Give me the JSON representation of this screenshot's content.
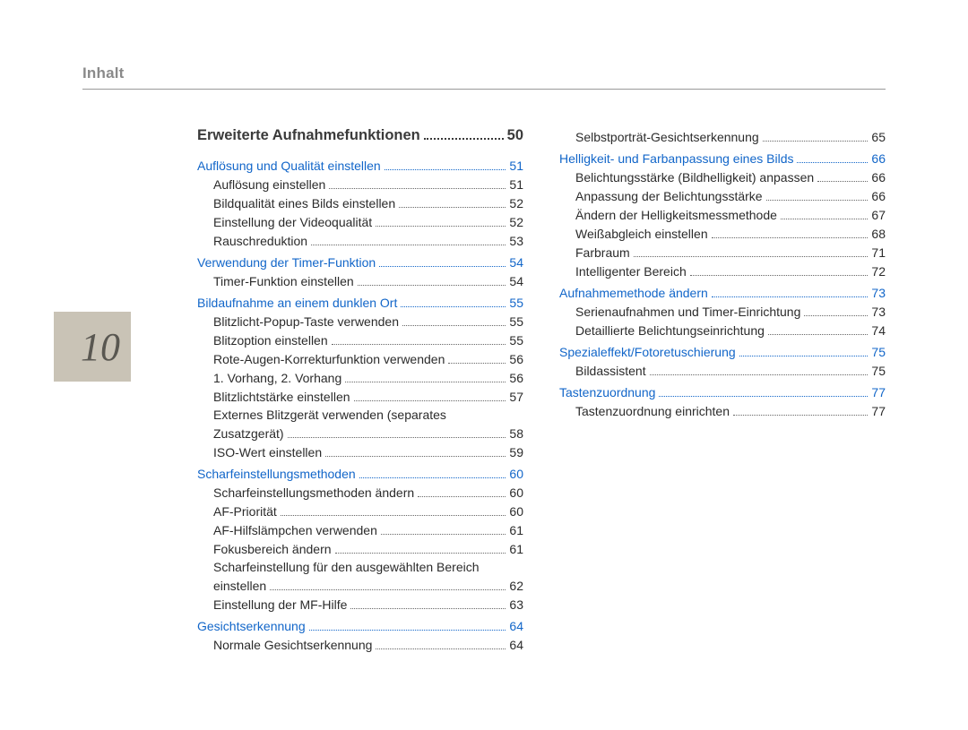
{
  "header": {
    "title": "Inhalt"
  },
  "pageNumber": "10",
  "chapter": {
    "title": "Erweiterte Aufnahmefunktionen",
    "page": "50"
  },
  "col1": [
    {
      "type": "section",
      "label": "Auflösung und Qualität einstellen",
      "page": "51"
    },
    {
      "type": "sub",
      "label": "Auflösung einstellen",
      "page": "51"
    },
    {
      "type": "sub",
      "label": "Bildqualität eines Bilds einstellen",
      "page": "52"
    },
    {
      "type": "sub",
      "label": "Einstellung der Videoqualität",
      "page": "52"
    },
    {
      "type": "sub",
      "label": "Rauschreduktion",
      "page": "53"
    },
    {
      "type": "section",
      "label": "Verwendung der Timer-Funktion",
      "page": "54"
    },
    {
      "type": "sub",
      "label": "Timer-Funktion einstellen",
      "page": "54"
    },
    {
      "type": "section",
      "label": "Bildaufnahme an einem dunklen Ort",
      "page": "55"
    },
    {
      "type": "sub",
      "label": "Blitzlicht-Popup-Taste verwenden",
      "page": "55"
    },
    {
      "type": "sub",
      "label": "Blitzoption einstellen",
      "page": "55"
    },
    {
      "type": "sub",
      "label": "Rote-Augen-Korrekturfunktion verwenden",
      "page": "56"
    },
    {
      "type": "sub",
      "label": "1. Vorhang, 2. Vorhang",
      "page": "56"
    },
    {
      "type": "sub",
      "label": "Blitzlichtstärke einstellen",
      "page": "57"
    },
    {
      "type": "wrap",
      "line1": "Externes Blitzgerät verwenden (separates",
      "line2": "Zusatzgerät)",
      "page": "58"
    },
    {
      "type": "sub",
      "label": "ISO-Wert einstellen",
      "page": "59"
    },
    {
      "type": "section",
      "label": "Scharfeinstellungsmethoden",
      "page": "60"
    },
    {
      "type": "sub",
      "label": "Scharfeinstellungsmethoden ändern",
      "page": "60"
    },
    {
      "type": "sub",
      "label": "AF-Priorität",
      "page": "60"
    },
    {
      "type": "sub",
      "label": "AF-Hilfslämpchen verwenden",
      "page": "61"
    },
    {
      "type": "sub",
      "label": "Fokusbereich ändern",
      "page": "61"
    },
    {
      "type": "wrap",
      "line1": "Scharfeinstellung für den ausgewählten Bereich",
      "line2": "einstellen",
      "page": "62"
    },
    {
      "type": "sub",
      "label": "Einstellung der MF-Hilfe",
      "page": "63"
    },
    {
      "type": "section",
      "label": "Gesichtserkennung",
      "page": "64"
    },
    {
      "type": "sub",
      "label": "Normale Gesichtserkennung",
      "page": "64"
    }
  ],
  "col2": [
    {
      "type": "sub",
      "label": "Selbstporträt-Gesichtserkennung",
      "page": "65"
    },
    {
      "type": "section",
      "label": "Helligkeit- und Farbanpassung eines Bilds",
      "page": "66"
    },
    {
      "type": "sub",
      "label": "Belichtungsstärke (Bildhelligkeit) anpassen",
      "page": "66"
    },
    {
      "type": "sub",
      "label": "Anpassung der Belichtungsstärke",
      "page": "66"
    },
    {
      "type": "sub",
      "label": "Ändern der Helligkeitsmessmethode",
      "page": "67"
    },
    {
      "type": "sub",
      "label": "Weißabgleich einstellen",
      "page": "68"
    },
    {
      "type": "sub",
      "label": "Farbraum",
      "page": "71"
    },
    {
      "type": "sub",
      "label": "Intelligenter Bereich",
      "page": "72"
    },
    {
      "type": "section",
      "label": "Aufnahmemethode ändern",
      "page": "73"
    },
    {
      "type": "sub",
      "label": "Serienaufnahmen und Timer-Einrichtung",
      "page": "73"
    },
    {
      "type": "sub",
      "label": "Detaillierte Belichtungseinrichtung",
      "page": "74"
    },
    {
      "type": "section",
      "label": "Spezialeffekt/Fotoretuschierung",
      "page": "75"
    },
    {
      "type": "sub",
      "label": "Bildassistent",
      "page": "75"
    },
    {
      "type": "section",
      "label": "Tastenzuordnung",
      "page": "77"
    },
    {
      "type": "sub",
      "label": "Tastenzuordnung einrichten",
      "page": "77"
    }
  ]
}
